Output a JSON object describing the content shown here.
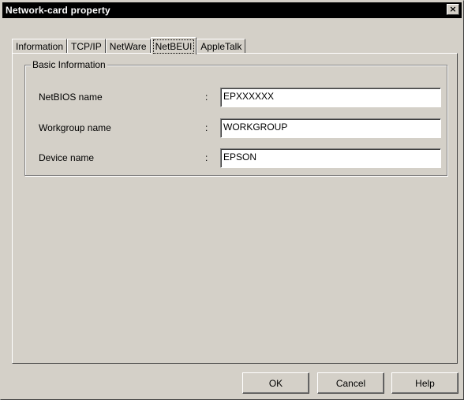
{
  "window": {
    "title": "Network-card property",
    "close_glyph": "×"
  },
  "tabs": [
    {
      "label": "Information",
      "active": false
    },
    {
      "label": "TCP/IP",
      "active": false
    },
    {
      "label": "NetWare",
      "active": false
    },
    {
      "label": "NetBEUI",
      "active": true
    },
    {
      "label": "AppleTalk",
      "active": false
    }
  ],
  "basic_info": {
    "legend": "Basic Information",
    "colon": ":",
    "fields": [
      {
        "label": "NetBIOS name",
        "value": "EPXXXXXX"
      },
      {
        "label": "Workgroup name",
        "value": "WORKGROUP"
      },
      {
        "label": "Device name",
        "value": "EPSON"
      }
    ]
  },
  "buttons": {
    "ok": "OK",
    "cancel": "Cancel",
    "help": "Help"
  }
}
